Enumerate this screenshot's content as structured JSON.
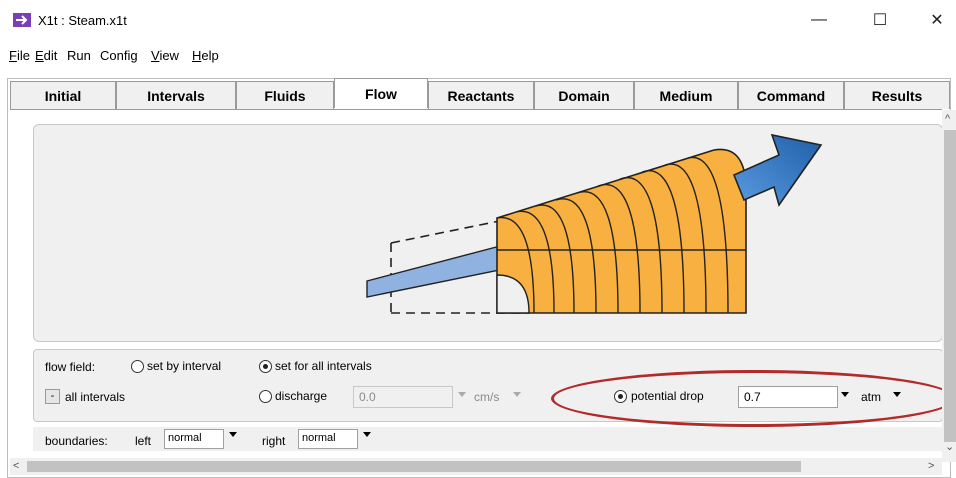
{
  "window": {
    "title": "X1t : Steam.x1t",
    "minimize": "—",
    "maximize": "☐",
    "close": "✕"
  },
  "menu": [
    {
      "pre": "",
      "ul": "F",
      "post": "ile"
    },
    {
      "pre": "",
      "ul": "E",
      "post": "dit"
    },
    {
      "pre": "R",
      "ul": "",
      "post": "un"
    },
    {
      "pre": "C",
      "ul": "",
      "post": "onfig"
    },
    {
      "pre": "",
      "ul": "V",
      "post": "iew"
    },
    {
      "pre": "",
      "ul": "H",
      "post": "elp"
    }
  ],
  "tabs": [
    "Initial",
    "Intervals",
    "Fluids",
    "Flow",
    "Reactants",
    "Domain",
    "Medium",
    "Command",
    "Results"
  ],
  "active_tab": "Flow",
  "flow": {
    "flow_field_label": "flow field:",
    "set_by_interval": "set by interval",
    "set_for_all": "set for all intervals",
    "collapse_btn": "-",
    "all_intervals": "all intervals",
    "discharge_label": "discharge",
    "discharge_value": "0.0",
    "discharge_unit": "cm/s",
    "potential_drop_label": "potential drop",
    "potential_drop_value": "0.7",
    "potential_drop_unit": "atm",
    "selected_mode": "potential drop",
    "flow_field_selection": "set for all intervals"
  },
  "boundaries": {
    "label": "boundaries:",
    "left_label": "left",
    "left_value": "normal",
    "right_label": "right",
    "right_value": "normal"
  },
  "colors": {
    "body_fill": "#f8b040",
    "arrow_blue": "#2a6fb8",
    "highlight": "#b22a2a",
    "app_icon": "#7a3fb5"
  }
}
